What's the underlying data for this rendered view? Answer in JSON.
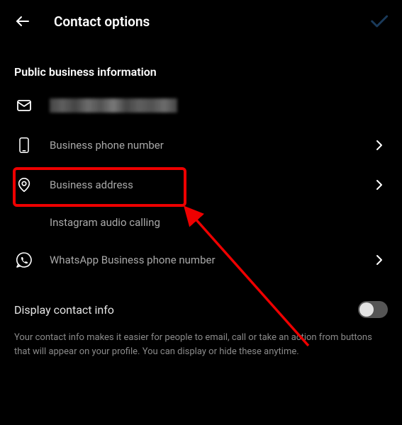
{
  "header": {
    "title": "Contact options"
  },
  "section": {
    "heading": "Public business information"
  },
  "items": {
    "email": {
      "label": ""
    },
    "phone": {
      "label": "Business phone number"
    },
    "address": {
      "label": "Business address"
    },
    "audio": {
      "label": "Instagram audio calling"
    },
    "whatsapp": {
      "label": "WhatsApp Business phone number"
    }
  },
  "display": {
    "label": "Display contact info",
    "description": "Your contact info makes it easier for people to email, call or take an action from buttons that will appear on your profile. You can display or hide these anytime.",
    "enabled": false
  }
}
